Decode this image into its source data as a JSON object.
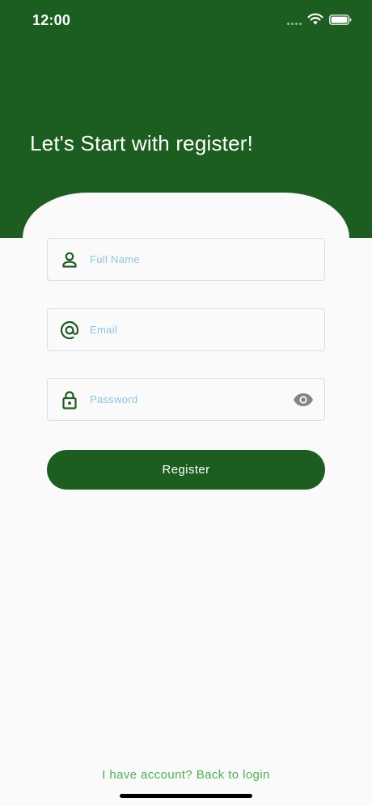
{
  "status_bar": {
    "time": "12:00"
  },
  "header": {
    "title": "Let's Start with register!"
  },
  "form": {
    "full_name": {
      "placeholder": "Full Name",
      "value": "",
      "icon": "person-icon"
    },
    "email": {
      "placeholder": "Email",
      "value": "",
      "icon": "at-sign-icon"
    },
    "password": {
      "placeholder": "Password",
      "value": "",
      "icon": "lock-icon",
      "toggle_icon": "eye-icon"
    },
    "register_label": "Register"
  },
  "footer": {
    "back_to_login": "I have account? Back to login"
  },
  "colors": {
    "primary": "#1c5e20",
    "placeholder": "#8ec5e3",
    "link": "#4caf50",
    "background": "#fafafa"
  }
}
